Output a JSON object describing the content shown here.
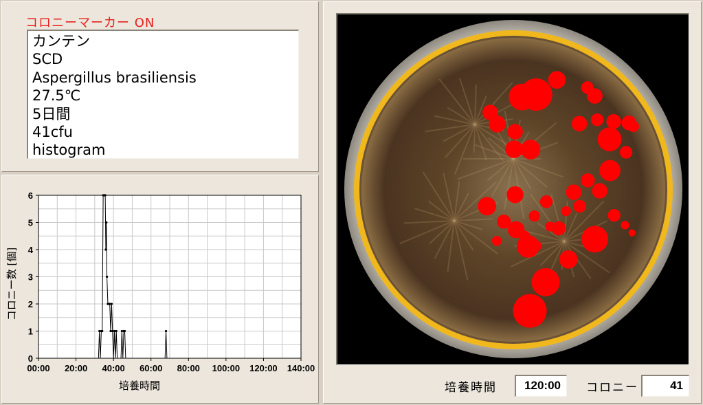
{
  "info": {
    "marker_status": "コロニーマーカー ON",
    "lines": [
      "カンテン",
      "SCD",
      "Aspergillus brasiliensis",
      "27.5℃",
      "5日間",
      "41cfu",
      "histogram"
    ]
  },
  "chart_data": {
    "type": "line",
    "xlabel": "培養時間",
    "ylabel": "コロニー数 [個]",
    "xlim": [
      0,
      140
    ],
    "ylim": [
      0,
      6
    ],
    "x_ticks": [
      "00:00",
      "20:00",
      "40:00",
      "60:00",
      "80:00",
      "100:00",
      "120:00",
      "140:00"
    ],
    "y_ticks": [
      "0",
      "1",
      "2",
      "3",
      "4",
      "5",
      "6"
    ],
    "grid": true,
    "series": [
      {
        "x": [
          5,
          6,
          7,
          8,
          9,
          10,
          11,
          12,
          13,
          14,
          15,
          16,
          17,
          18,
          19,
          20,
          21,
          22,
          23,
          24,
          25,
          26,
          27,
          28,
          29,
          30,
          31,
          32,
          32.5,
          33,
          33.5,
          34,
          34.5,
          35,
          35.3,
          35.6,
          35.9,
          36.2,
          36.5,
          37,
          37.5,
          38,
          38.5,
          39,
          39.5,
          40,
          40.5,
          41,
          41.5,
          42,
          43,
          44,
          44.5,
          45,
          45.5,
          46,
          46.5,
          47,
          48,
          50,
          55,
          60,
          65,
          67.5,
          68,
          68.5,
          70,
          80,
          90,
          100,
          110,
          120
        ],
        "y": [
          0,
          0,
          0,
          0,
          0,
          0,
          0,
          0,
          0,
          0,
          0,
          0,
          0,
          0,
          0,
          0,
          0,
          0,
          0,
          0,
          0,
          0,
          0,
          0,
          0,
          0,
          0,
          0,
          1,
          0,
          1,
          1,
          6,
          6,
          6,
          6,
          4,
          5,
          3,
          2,
          2,
          2,
          1,
          2,
          1,
          0,
          1,
          0,
          1,
          0,
          0,
          0,
          1,
          0,
          1,
          1,
          0,
          0,
          0,
          0,
          0,
          0,
          0,
          0,
          1,
          0,
          0,
          0,
          0,
          0,
          0,
          0
        ]
      }
    ]
  },
  "plate": {
    "rim_color": "#f0b81c",
    "agar_color": "#5a4128",
    "colony_color": "#ff0000",
    "colonies": [
      [
        0.526,
        0.236,
        0.038
      ],
      [
        0.566,
        0.229,
        0.046
      ],
      [
        0.625,
        0.187,
        0.025
      ],
      [
        0.712,
        0.209,
        0.018
      ],
      [
        0.733,
        0.233,
        0.022
      ],
      [
        0.435,
        0.28,
        0.022
      ],
      [
        0.455,
        0.313,
        0.024
      ],
      [
        0.506,
        0.335,
        0.022
      ],
      [
        0.503,
        0.385,
        0.025
      ],
      [
        0.55,
        0.386,
        0.028
      ],
      [
        0.689,
        0.312,
        0.022
      ],
      [
        0.74,
        0.301,
        0.018
      ],
      [
        0.787,
        0.306,
        0.021
      ],
      [
        0.83,
        0.31,
        0.021
      ],
      [
        0.843,
        0.32,
        0.016
      ],
      [
        0.775,
        0.357,
        0.034
      ],
      [
        0.822,
        0.394,
        0.018
      ],
      [
        0.776,
        0.446,
        0.03
      ],
      [
        0.713,
        0.474,
        0.02
      ],
      [
        0.673,
        0.508,
        0.022
      ],
      [
        0.69,
        0.548,
        0.018
      ],
      [
        0.595,
        0.535,
        0.018
      ],
      [
        0.506,
        0.515,
        0.024
      ],
      [
        0.426,
        0.548,
        0.026
      ],
      [
        0.474,
        0.592,
        0.02
      ],
      [
        0.509,
        0.615,
        0.024
      ],
      [
        0.533,
        0.634,
        0.016
      ],
      [
        0.565,
        0.661,
        0.016
      ],
      [
        0.63,
        0.611,
        0.02
      ],
      [
        0.561,
        0.576,
        0.016
      ],
      [
        0.606,
        0.606,
        0.014
      ],
      [
        0.651,
        0.562,
        0.014
      ],
      [
        0.788,
        0.574,
        0.018
      ],
      [
        0.819,
        0.602,
        0.012
      ],
      [
        0.839,
        0.624,
        0.01
      ],
      [
        0.747,
        0.504,
        0.022
      ],
      [
        0.733,
        0.642,
        0.038
      ],
      [
        0.658,
        0.7,
        0.026
      ],
      [
        0.543,
        0.663,
        0.032
      ],
      [
        0.454,
        0.647,
        0.014
      ],
      [
        0.593,
        0.765,
        0.04
      ],
      [
        0.548,
        0.847,
        0.048
      ]
    ]
  },
  "status": {
    "time_label": "培養時間",
    "time_value": "120:00",
    "colony_label": "コロニー",
    "colony_value": "41"
  }
}
